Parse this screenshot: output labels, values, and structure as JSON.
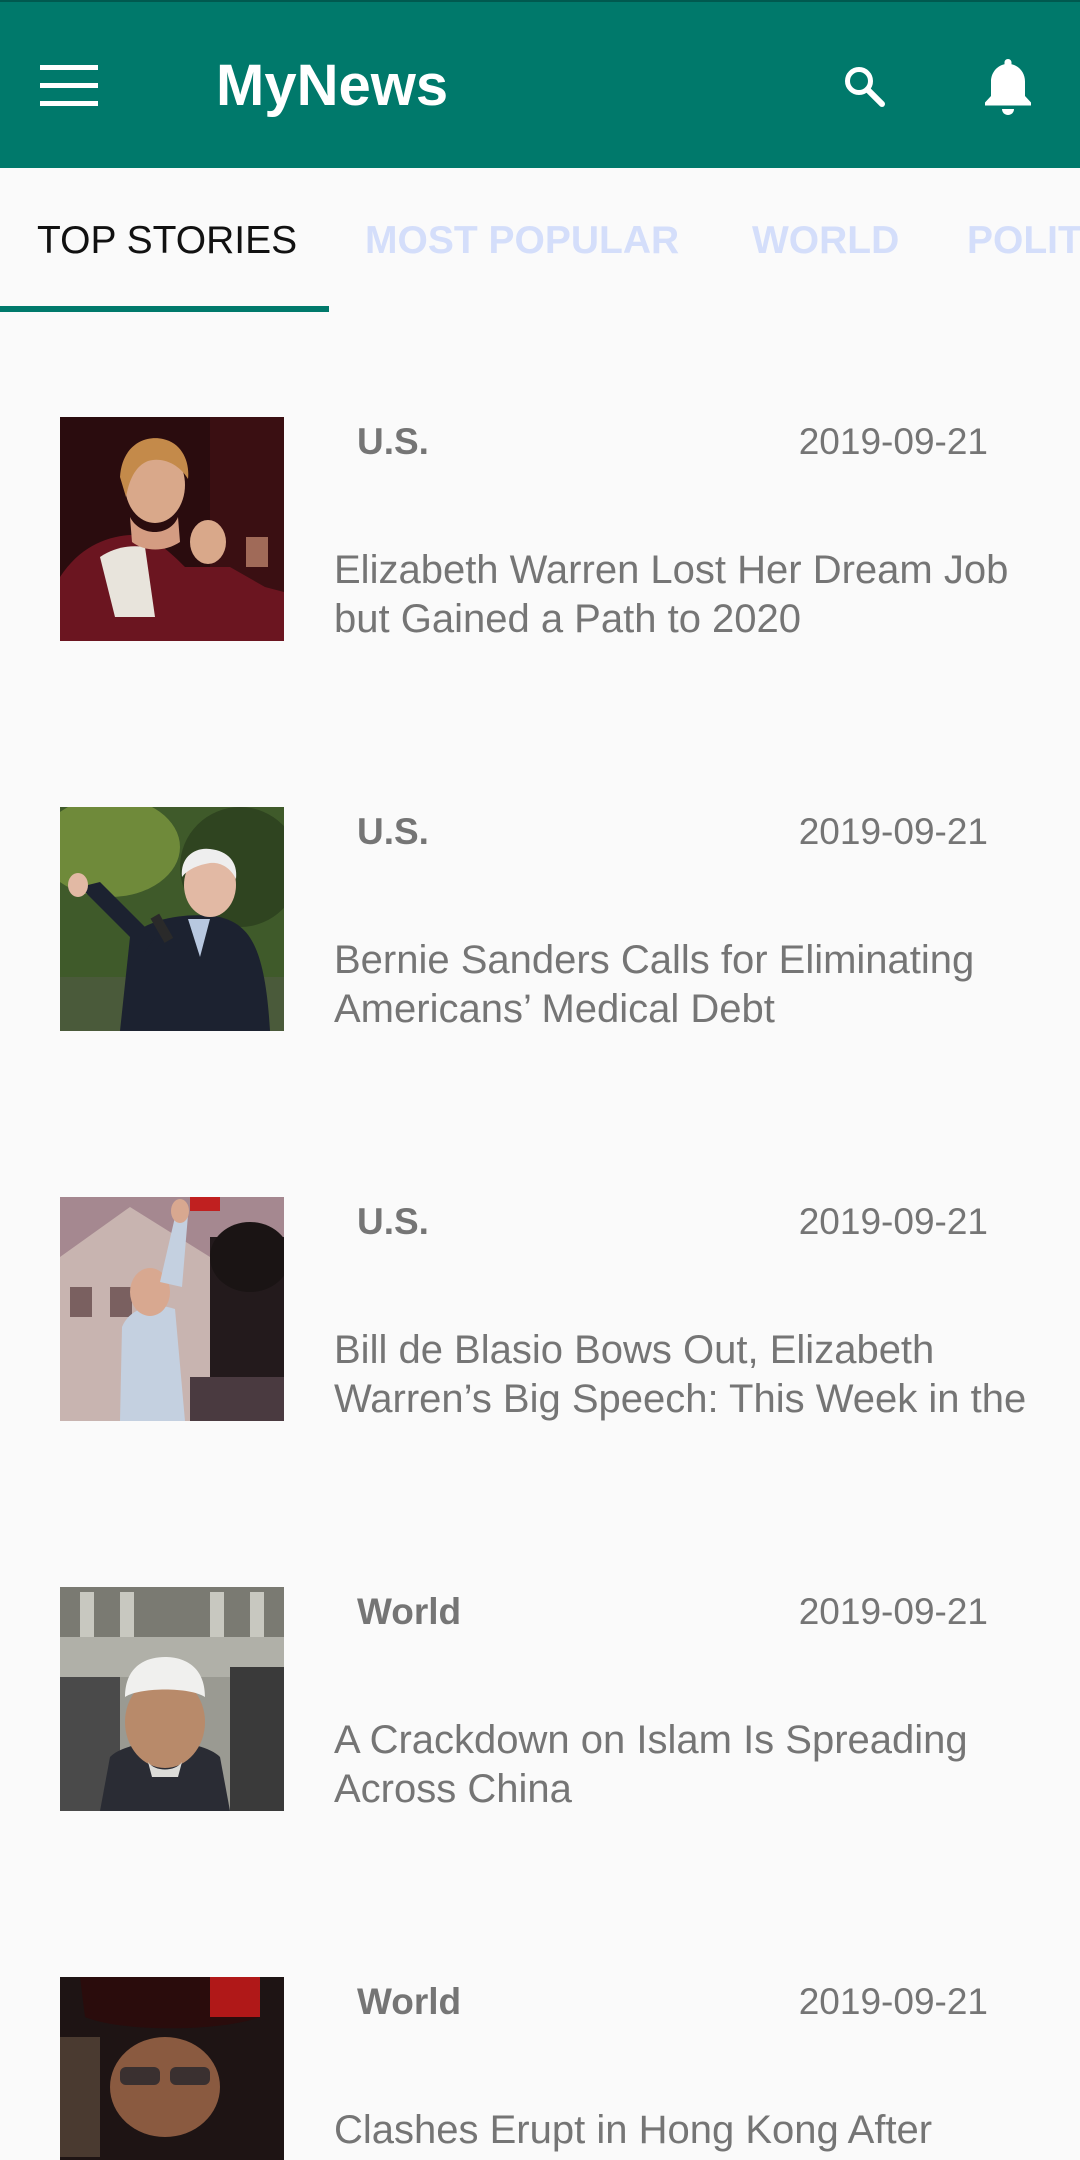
{
  "app": {
    "title": "MyNews",
    "accent_color": "#00796b",
    "menu_icon": "hamburger-menu-icon",
    "search_icon": "search-icon",
    "notifications_icon": "bell-icon"
  },
  "tabs": [
    {
      "label": "TOP STORIES",
      "active": true
    },
    {
      "label": "MOST POPULAR",
      "active": false
    },
    {
      "label": "WORLD",
      "active": false
    },
    {
      "label": "POLIT",
      "active": false
    }
  ],
  "stories": [
    {
      "section": "U.S.",
      "date": "2019-09-21",
      "headline": "Elizabeth Warren Lost Her Dream Job but Gained a Path to 2020"
    },
    {
      "section": "U.S.",
      "date": "2019-09-21",
      "headline": "Bernie Sanders Calls for Eliminating Americans’ Medical Debt"
    },
    {
      "section": "U.S.",
      "date": "2019-09-21",
      "headline": "Bill de Blasio Bows Out, Elizabeth Warren’s Big Speech: This Week in the"
    },
    {
      "section": "World",
      "date": "2019-09-21",
      "headline": "A Crackdown on Islam Is Spreading Across China"
    },
    {
      "section": "World",
      "date": "2019-09-21",
      "headline": "Clashes Erupt in Hong Kong After"
    }
  ]
}
